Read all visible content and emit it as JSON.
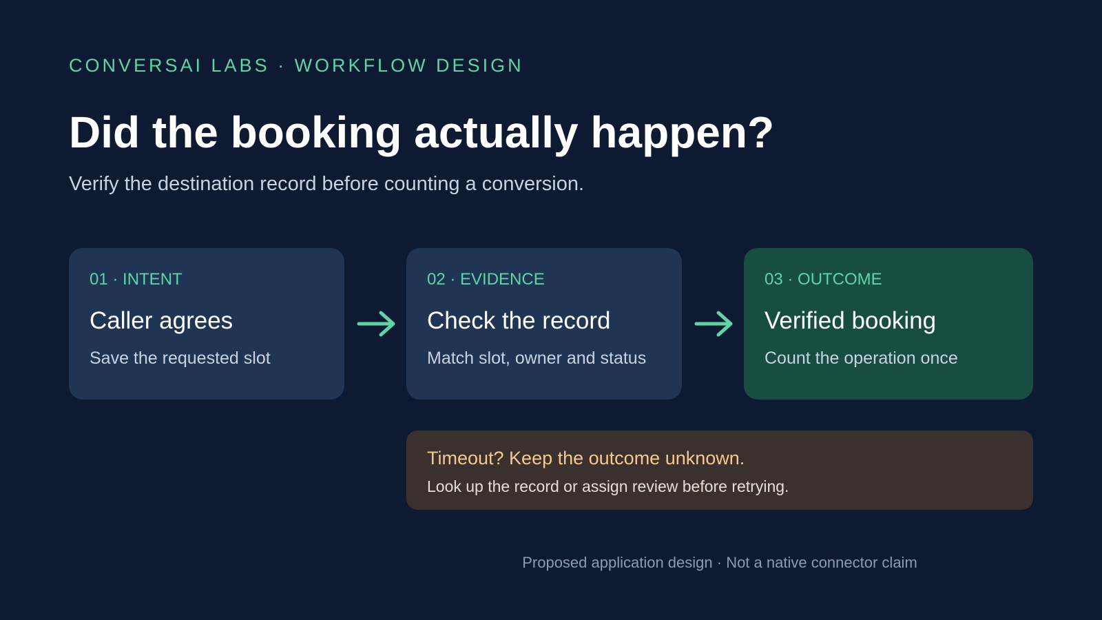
{
  "header": {
    "eyebrow": "CONVERSAI LABS · WORKFLOW DESIGN",
    "title": "Did the booking actually happen?",
    "subtitle": "Verify the destination record before counting a conversion."
  },
  "steps": [
    {
      "step": "01 · INTENT",
      "heading": "Caller agrees",
      "description": "Save the requested slot"
    },
    {
      "step": "02 · EVIDENCE",
      "heading": "Check the record",
      "description": "Match slot, owner and status"
    },
    {
      "step": "03 · OUTCOME",
      "heading": "Verified booking",
      "description": "Count the operation once"
    }
  ],
  "note": {
    "warning": "Timeout? Keep the outcome unknown.",
    "hint": "Look up the record or assign review before retrying."
  },
  "footer": "Proposed application design · Not a native connector claim",
  "colors": {
    "background": "#0e1a31",
    "accent": "#5fd4a8",
    "card": "#203553",
    "outcome_card": "#184d42",
    "note_card": "#3a302d",
    "note_warning": "#f5c98b"
  },
  "icons": {
    "connector": "arrow-right-icon"
  }
}
